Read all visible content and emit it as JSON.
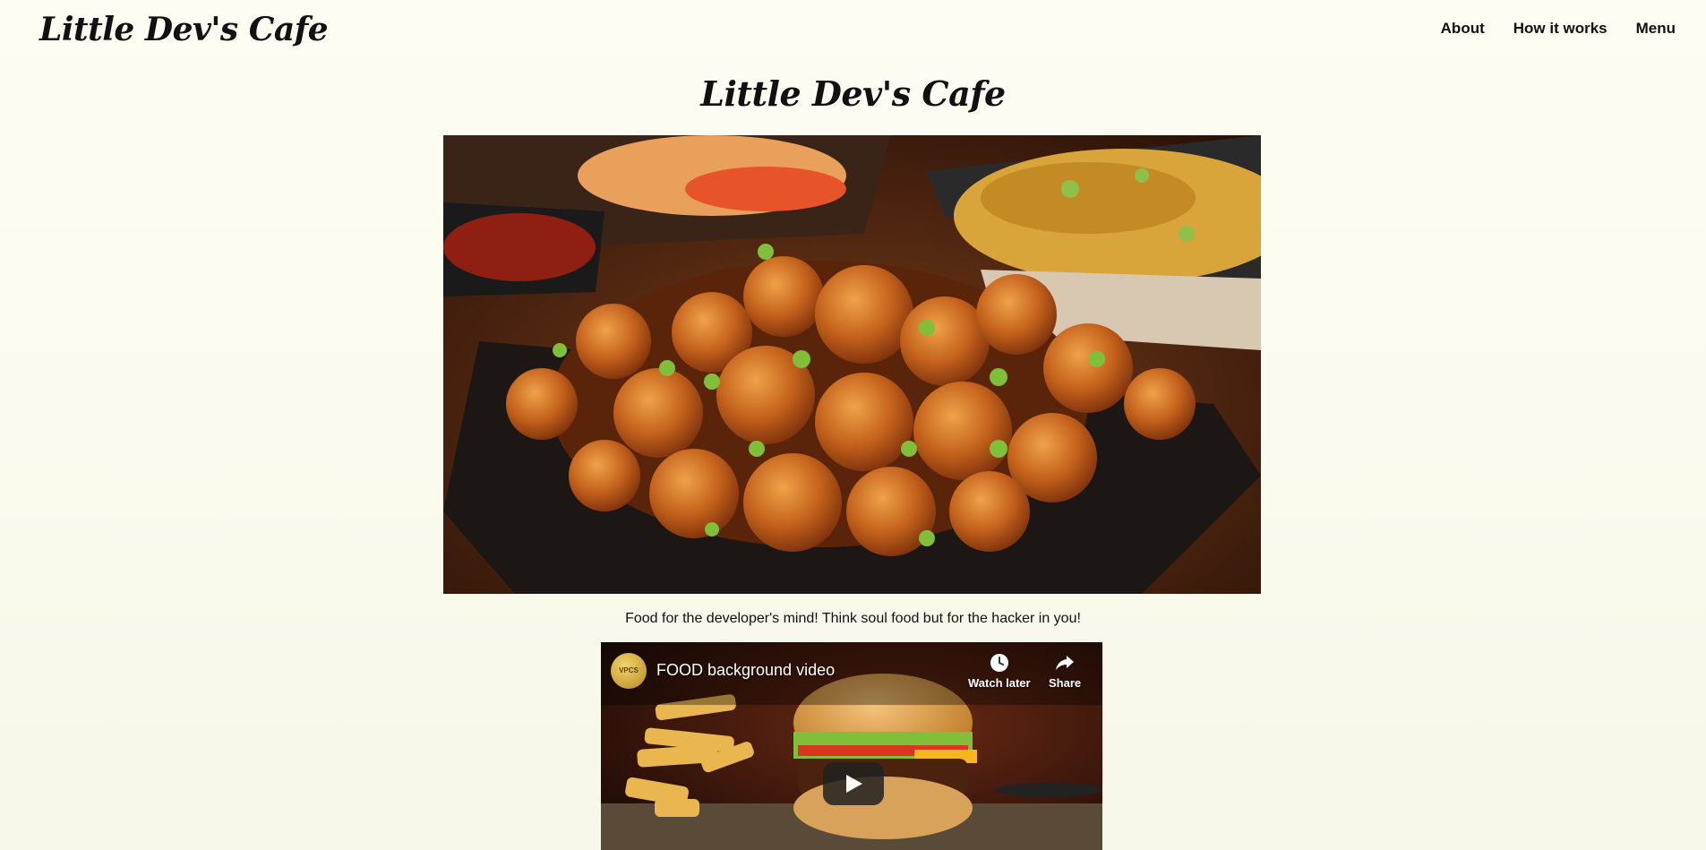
{
  "navbar": {
    "logo": "Little Dev's Cafe",
    "links": [
      "About",
      "How it works",
      "Menu"
    ]
  },
  "hero": {
    "title": "Little Dev's Cafe",
    "tagline": "Food for the developer's mind! Think soul food but for the hacker in you!"
  },
  "video": {
    "title": "FOOD background video",
    "channel_badge": "VPCS",
    "watch_later_label": "Watch later",
    "share_label": "Share"
  }
}
